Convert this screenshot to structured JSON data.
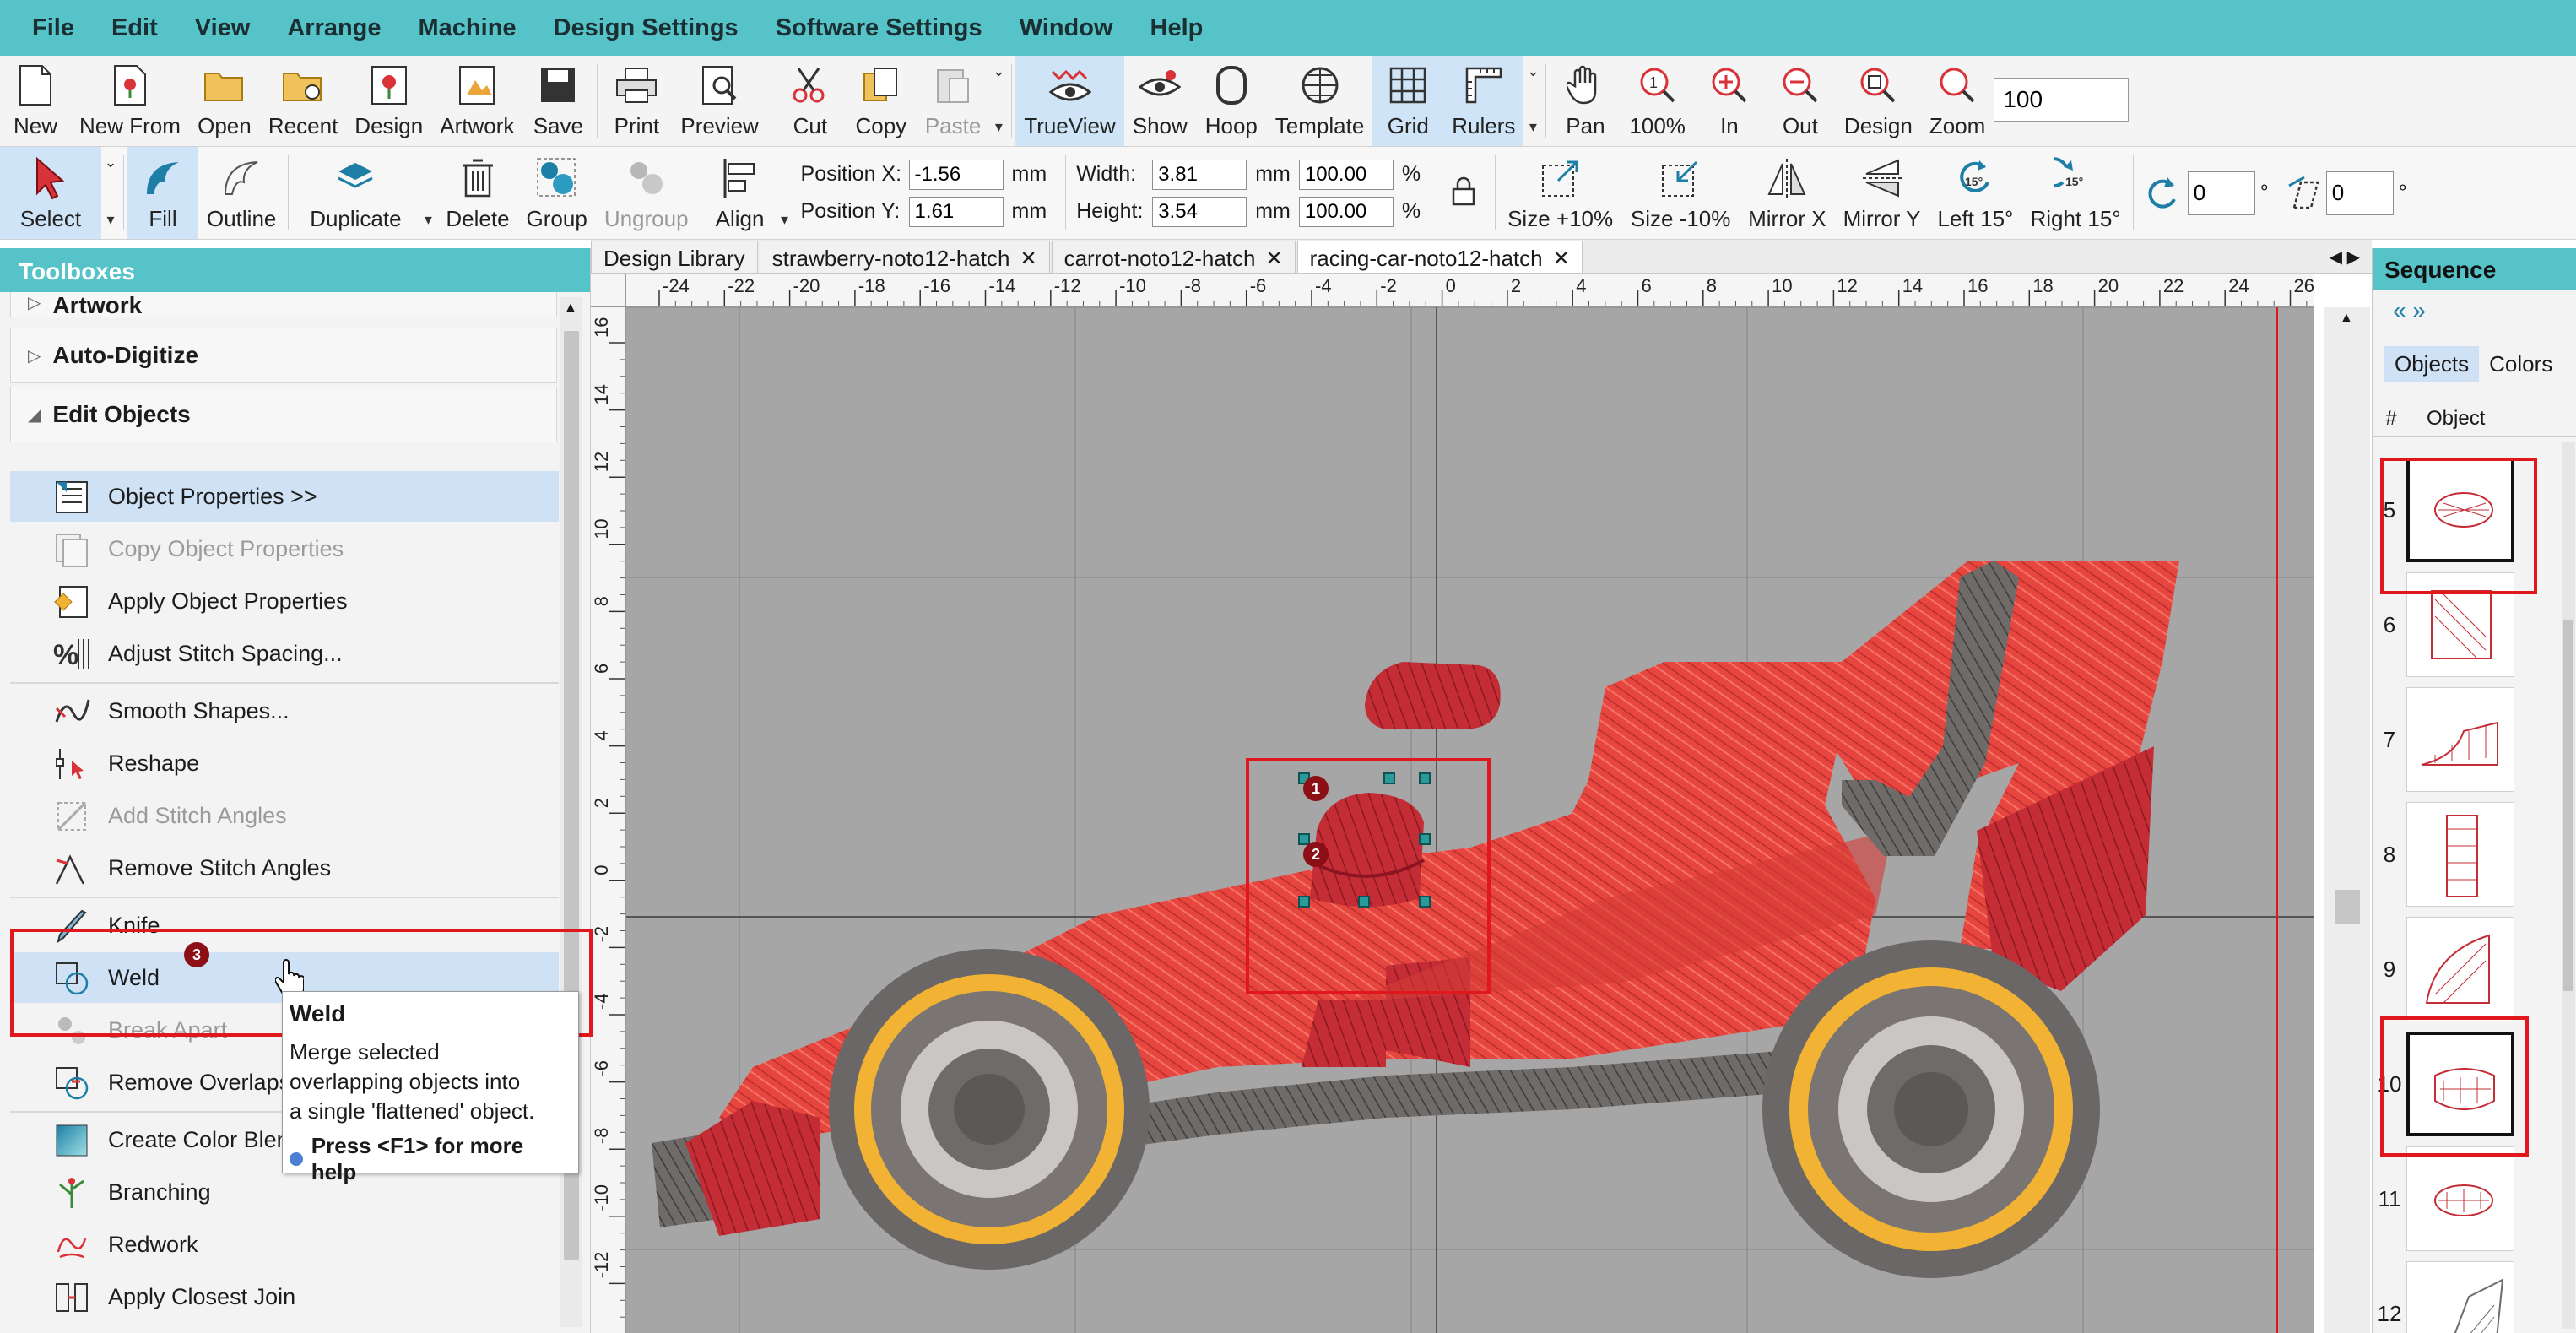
{
  "menu": [
    "File",
    "Edit",
    "View",
    "Arrange",
    "Machine",
    "Design Settings",
    "Software Settings",
    "Window",
    "Help"
  ],
  "toolbar1": {
    "file_group": [
      "New",
      "New From",
      "Open",
      "Recent",
      "Design",
      "Artwork",
      "Save"
    ],
    "print_group": [
      "Print",
      "Preview"
    ],
    "clip_group": [
      "Cut",
      "Copy",
      "Paste"
    ],
    "view_group": [
      "TrueView",
      "Show",
      "Hoop",
      "Template",
      "Grid",
      "Rulers"
    ],
    "zoom_group": [
      "Pan",
      "100%",
      "In",
      "Out",
      "Design",
      "Zoom"
    ],
    "zoom_value": "100"
  },
  "toolbar2": {
    "select": "Select",
    "fill_group": [
      "Fill",
      "Outline"
    ],
    "edit_group": [
      "Duplicate",
      "Delete",
      "Group",
      "Ungroup",
      "Align"
    ],
    "position_x_label": "Position X:",
    "position_x": "-1.56",
    "position_y_label": "Position Y:",
    "position_y": "1.61",
    "unit_mm": "mm",
    "width_label": "Width:",
    "width": "3.81",
    "height_label": "Height:",
    "height": "3.54",
    "width_pct": "100.00",
    "height_pct": "100.00",
    "pct": "%",
    "transform_group": [
      "Size +10%",
      "Size -10%",
      "Mirror X",
      "Mirror Y",
      "Left 15°",
      "Right 15°"
    ],
    "rotate_value": "0",
    "skew_value": "0",
    "deg": "°"
  },
  "toolboxes": {
    "title": "Toolboxes",
    "sections": [
      "Artwork",
      "Auto-Digitize",
      "Edit Objects"
    ],
    "tools": [
      {
        "label": "Object Properties >>",
        "state": "highlight"
      },
      {
        "label": "Copy Object Properties",
        "state": "disabled"
      },
      {
        "label": "Apply Object Properties",
        "state": "normal"
      },
      {
        "label": "Adjust Stitch Spacing...",
        "state": "normal"
      },
      {
        "label": "Smooth Shapes...",
        "state": "normal"
      },
      {
        "label": "Reshape",
        "state": "normal"
      },
      {
        "label": "Add Stitch Angles",
        "state": "disabled"
      },
      {
        "label": "Remove Stitch Angles",
        "state": "normal"
      },
      {
        "label": "Knife",
        "state": "normal"
      },
      {
        "label": "Weld",
        "state": "highlight"
      },
      {
        "label": "Break Apart",
        "state": "disabled"
      },
      {
        "label": "Remove Overlaps",
        "state": "normal"
      },
      {
        "label": "Create Color Blend",
        "state": "normal"
      },
      {
        "label": "Branching",
        "state": "normal"
      },
      {
        "label": "Redwork",
        "state": "normal"
      },
      {
        "label": "Apply Closest Join",
        "state": "normal"
      }
    ]
  },
  "tabs": [
    {
      "label": "Design Library",
      "closable": false
    },
    {
      "label": "strawberry-noto12-hatch",
      "closable": true
    },
    {
      "label": "carrot-noto12-hatch",
      "closable": true
    },
    {
      "label": "racing-car-noto12-hatch",
      "closable": true,
      "active": true
    }
  ],
  "ruler": {
    "x_ticks": [
      "-24",
      "-22",
      "-20",
      "-18",
      "-16",
      "-14",
      "-12",
      "-10",
      "-8",
      "-6",
      "-4",
      "-2",
      "0",
      "2",
      "4",
      "6",
      "8",
      "10",
      "12",
      "14",
      "16",
      "18",
      "20",
      "22",
      "24",
      "26"
    ],
    "y_ticks": [
      "16",
      "14",
      "12",
      "10",
      "8",
      "6",
      "4",
      "2",
      "0",
      "-2",
      "-4",
      "-6",
      "-8",
      "-10",
      "-12"
    ]
  },
  "tooltip": {
    "title": "Weld",
    "body_lines": [
      "Merge selected",
      "overlapping objects into",
      "a single 'flattened' object."
    ],
    "help": "Press <F1> for more help"
  },
  "badges": [
    "1",
    "2",
    "3"
  ],
  "sequence": {
    "title": "Sequence",
    "tabs": [
      "Objects",
      "Colors"
    ],
    "col_num": "#",
    "col_object": "Object",
    "items": [
      {
        "num": "5",
        "selected": true
      },
      {
        "num": "6",
        "selected": false
      },
      {
        "num": "7",
        "selected": false
      },
      {
        "num": "8",
        "selected": false
      },
      {
        "num": "9",
        "selected": false
      },
      {
        "num": "10",
        "selected": true
      },
      {
        "num": "11",
        "selected": false
      },
      {
        "num": "12",
        "selected": false
      }
    ]
  },
  "colors": {
    "menubar": "#56c3c8",
    "annotation": "#e0181e",
    "stitch_red": "#e8453f",
    "stitch_dark_red": "#b8242c",
    "stitch_gray": "#6f6b69",
    "stitch_gold": "#f2b233",
    "canvas_bg": "#a6a6a6"
  }
}
